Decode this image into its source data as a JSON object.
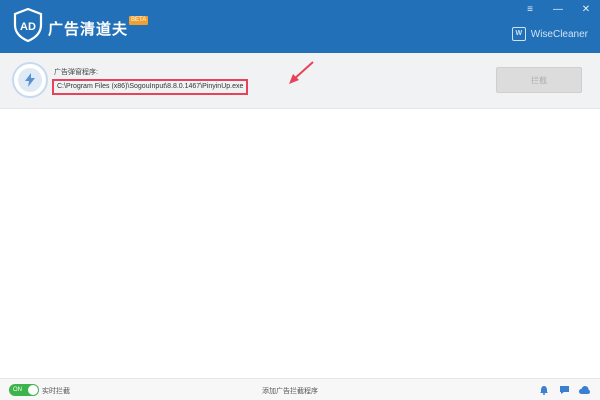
{
  "titlebar": {
    "app_title": "广告清道夫",
    "badge": "BETA",
    "controls": {
      "menu": "≡",
      "minimize": "—",
      "close": "✕"
    },
    "brand": {
      "mark": "W",
      "name": "WiseCleaner"
    }
  },
  "info_bar": {
    "label": "广告弹窗程序:",
    "path": "C:\\Program Files (x86)\\SogouInput\\8.8.0.1467\\PinyinUp.exe",
    "action_button": "拦截"
  },
  "statusbar": {
    "toggle_text": "ON",
    "toggle_label": "实时拦截",
    "center_link": "添加广告拦截程序"
  },
  "colors": {
    "titlebar": "#2271b8",
    "highlight": "#e8425a",
    "toggle_on": "#3cb44b"
  }
}
